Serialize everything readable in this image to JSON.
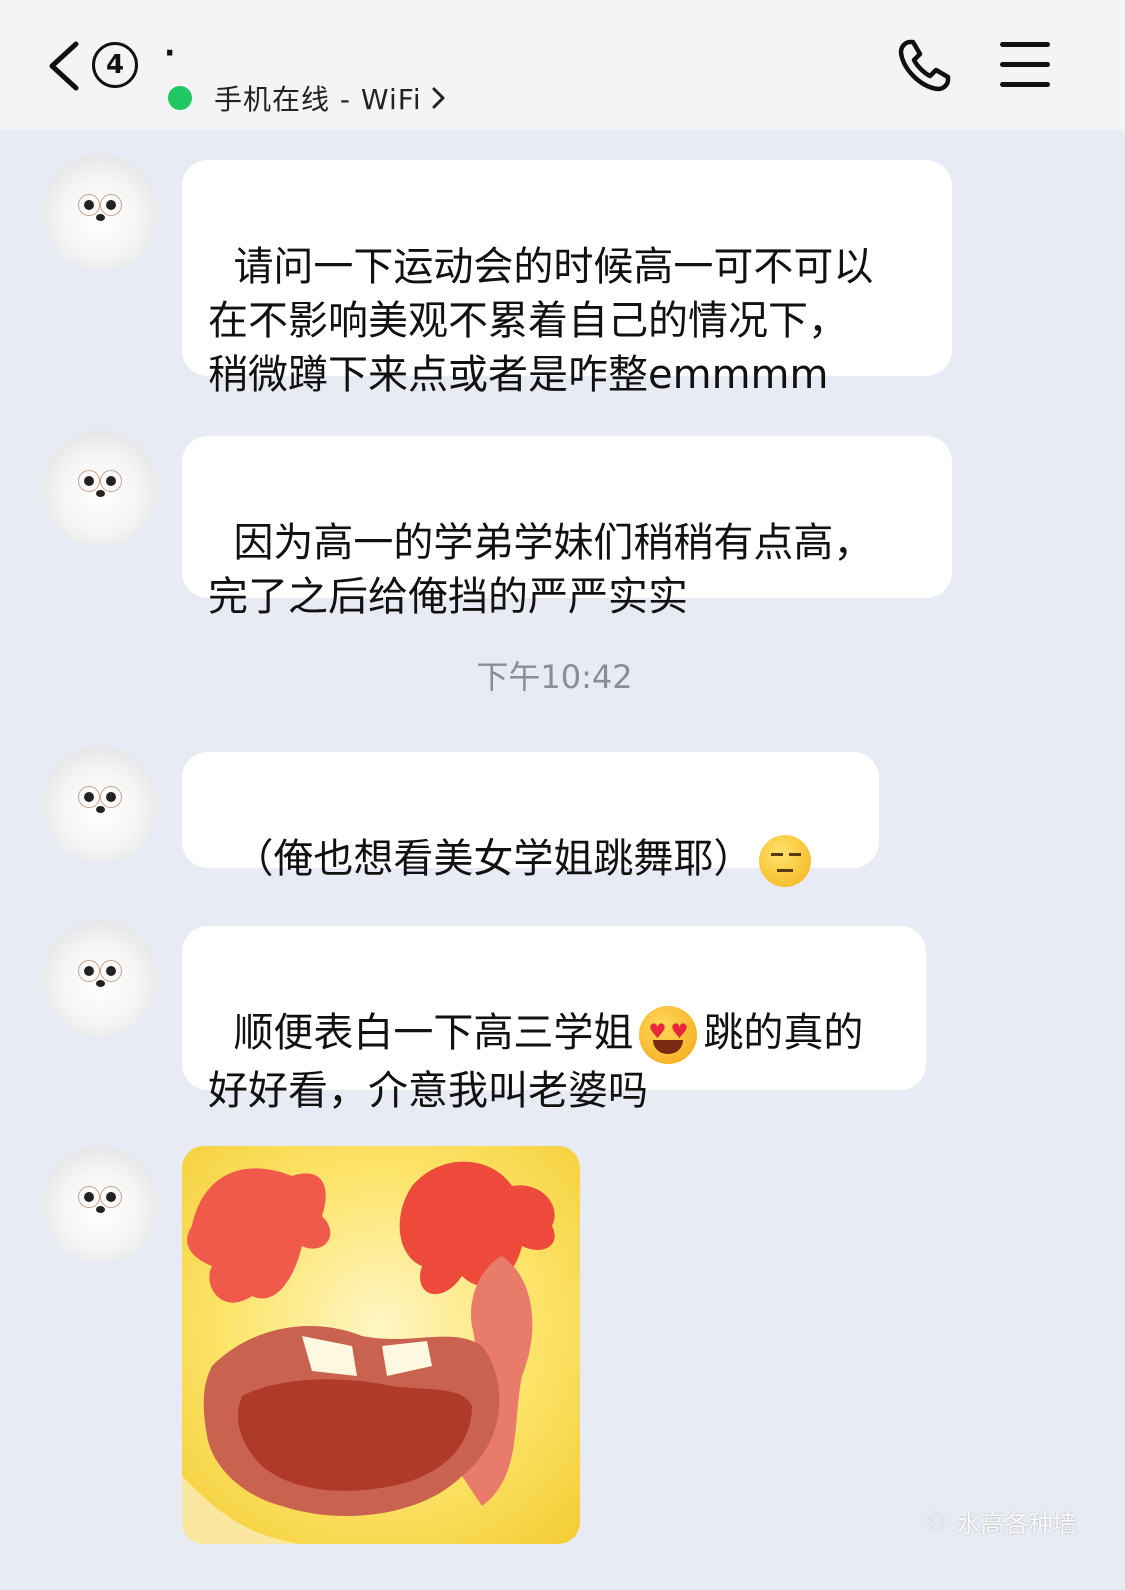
{
  "header": {
    "unread_count": "4",
    "contact_name": "·",
    "status_text": "手机在线 - WiFi"
  },
  "messages": [
    {
      "type": "text",
      "text": "请问一下运动会的时候高一可不可以\n在不影响美观不累着自己的情况下，\n稍微蹲下来点或者是咋整emmmm"
    },
    {
      "type": "text",
      "text": "因为高一的学弟学妹们稍稍有点高，\n完了之后给俺挡的严严实实"
    },
    {
      "type": "text",
      "text": "（俺也想看美女学姐跳舞耶）"
    },
    {
      "type": "text",
      "text_before": "顺便表白一下高三学姐",
      "text_after": "跳的真的\n好好看，介意我叫老婆吗"
    },
    {
      "type": "sticker",
      "description": "sticker"
    }
  ],
  "timestamp": "下午10:42",
  "watermark": "水高各种墙",
  "colors": {
    "background": "#e9ebf4",
    "header": "#f4f4f6",
    "bubble": "#ffffff",
    "online": "#20c864",
    "timestamp": "#8b8d94"
  }
}
